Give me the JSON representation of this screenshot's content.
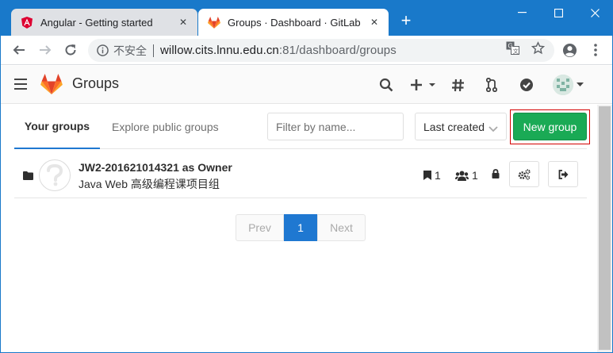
{
  "browser": {
    "tabs": [
      {
        "title": "Angular - Getting started",
        "favicon": "angular-icon",
        "active": false
      },
      {
        "title": "Groups · Dashboard · GitLab",
        "favicon": "gitlab-icon",
        "active": true
      }
    ],
    "new_tab_label": "+",
    "omnibox": {
      "security_label": "不安全",
      "url_host": "willow.cits.lnnu.edu.cn",
      "url_rest": ":81/dashboard/groups"
    }
  },
  "header": {
    "brand": "Groups"
  },
  "subnav": {
    "tabs": [
      {
        "label": "Your groups",
        "active": true
      },
      {
        "label": "Explore public groups",
        "active": false
      }
    ],
    "filter_placeholder": "Filter by name...",
    "sort_label": "Last created",
    "new_group_label": "New group"
  },
  "groups": [
    {
      "name": "JW2-201621014321 as Owner",
      "description": "Java Web 高级编程课项目组",
      "projects": "1",
      "members": "1"
    }
  ],
  "pagination": {
    "prev": "Prev",
    "current": "1",
    "next": "Next"
  },
  "colors": {
    "chrome_blue": "#1979ca",
    "gitlab_green": "#1aaa55",
    "pager_blue": "#1f78d1",
    "highlight_red": "#d40000"
  }
}
